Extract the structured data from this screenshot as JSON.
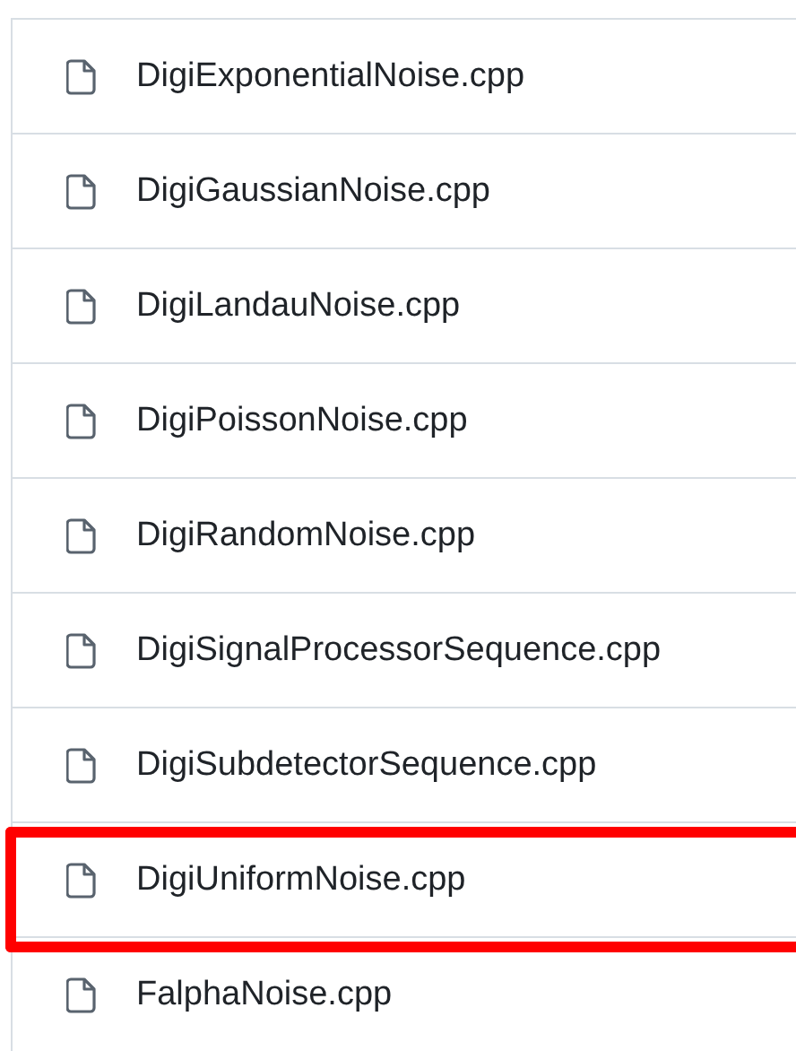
{
  "files": [
    {
      "name": "DigiExponentialNoise.cpp",
      "highlighted": false
    },
    {
      "name": "DigiGaussianNoise.cpp",
      "highlighted": false
    },
    {
      "name": "DigiLandauNoise.cpp",
      "highlighted": false
    },
    {
      "name": "DigiPoissonNoise.cpp",
      "highlighted": false
    },
    {
      "name": "DigiRandomNoise.cpp",
      "highlighted": false
    },
    {
      "name": "DigiSignalProcessorSequence.cpp",
      "highlighted": false
    },
    {
      "name": "DigiSubdetectorSequence.cpp",
      "highlighted": false
    },
    {
      "name": "DigiUniformNoise.cpp",
      "highlighted": true
    },
    {
      "name": "FalphaNoise.cpp",
      "highlighted": false
    }
  ]
}
